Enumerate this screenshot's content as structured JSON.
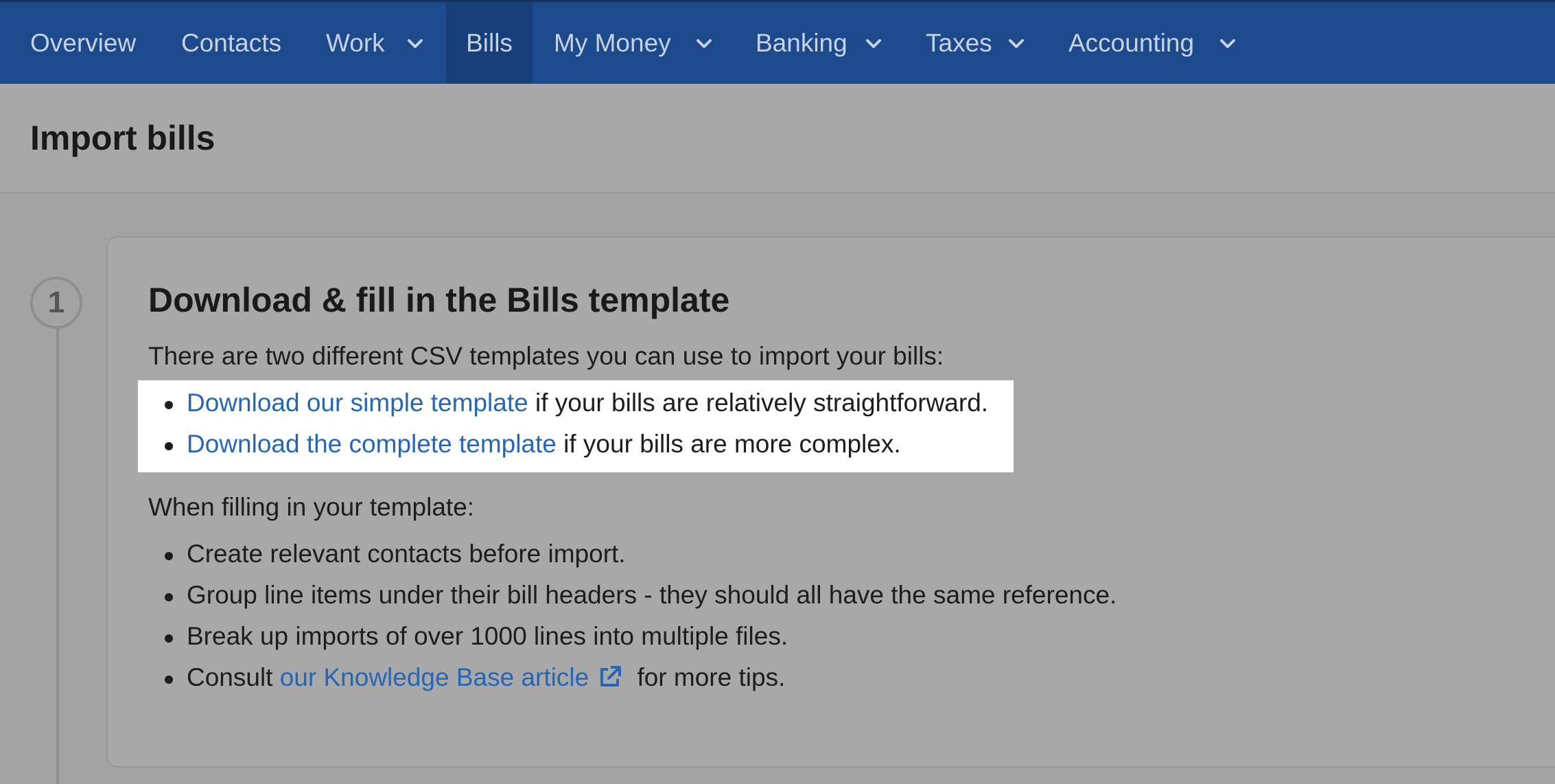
{
  "nav": {
    "items": [
      {
        "label": "Overview",
        "has_dropdown": false,
        "active": false
      },
      {
        "label": "Contacts",
        "has_dropdown": false,
        "active": false
      },
      {
        "label": "Work",
        "has_dropdown": true,
        "active": false
      },
      {
        "label": "Bills",
        "has_dropdown": false,
        "active": true
      },
      {
        "label": "My Money",
        "has_dropdown": true,
        "active": false
      },
      {
        "label": "Banking",
        "has_dropdown": true,
        "active": false
      },
      {
        "label": "Taxes",
        "has_dropdown": true,
        "active": false
      },
      {
        "label": "Accounting",
        "has_dropdown": true,
        "active": false
      }
    ]
  },
  "page": {
    "title": "Import bills"
  },
  "step": {
    "number": "1",
    "title": "Download & fill in the Bills template",
    "intro": "There are two different CSV templates you can use to import your bills:",
    "templates": [
      {
        "link": "Download our simple template",
        "rest": " if your bills are relatively straightforward."
      },
      {
        "link": "Download the complete template",
        "rest": " if your bills are more complex."
      }
    ],
    "tips_heading": "When filling in your template:",
    "tips": [
      "Create relevant contacts before import.",
      "Group line items under their bill headers - they should all have the same reference.",
      "Break up imports of over 1000 lines into multiple files."
    ],
    "last_tip": {
      "prefix": "Consult ",
      "link": "our Knowledge Base article",
      "suffix": " for more tips."
    }
  },
  "colors": {
    "nav_bg": "#1c4a8c",
    "link": "#2566b5",
    "highlight": "#ffffff"
  },
  "icons": {
    "dropdown": "chevron-down-icon",
    "external": "external-link-icon"
  }
}
